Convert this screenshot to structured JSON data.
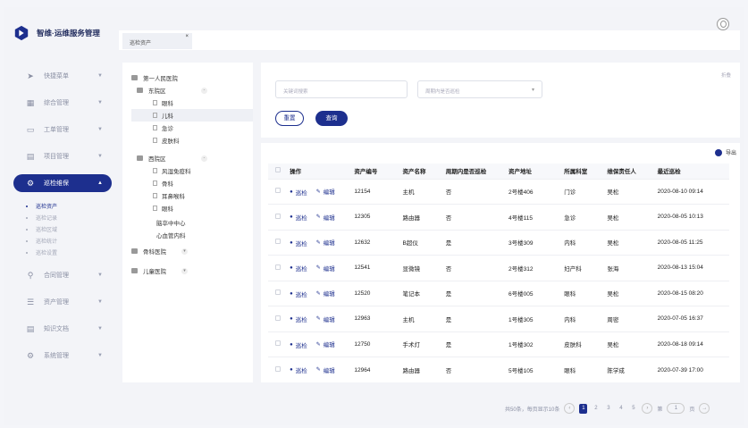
{
  "app": {
    "title": "智维·运维服务管理"
  },
  "sidebar": {
    "items": [
      {
        "label": "快捷菜单",
        "icon": "send-icon"
      },
      {
        "label": "综合管理",
        "icon": "grid-icon"
      },
      {
        "label": "工单管理",
        "icon": "ticket-icon"
      },
      {
        "label": "项目管理",
        "icon": "folder-icon"
      },
      {
        "label": "巡检维保",
        "icon": "wrench-icon",
        "active": true
      },
      {
        "label": "合同管理",
        "icon": "person-icon"
      },
      {
        "label": "资产管理",
        "icon": "database-icon"
      },
      {
        "label": "知识文档",
        "icon": "doc-icon"
      },
      {
        "label": "系统管理",
        "icon": "gear-icon"
      }
    ],
    "submenu": [
      {
        "label": "巡检资产",
        "active": true
      },
      {
        "label": "巡检记录"
      },
      {
        "label": "巡检区域"
      },
      {
        "label": "巡检统计"
      },
      {
        "label": "巡检设置"
      }
    ]
  },
  "topbar": {
    "tab_label": "巡检资产",
    "tab_close": "×"
  },
  "tree": {
    "root": "第一人民医院",
    "east": "东院区",
    "east_children": [
      "眼科",
      "儿科",
      "急诊",
      "皮肤科"
    ],
    "west": "西院区",
    "west_children": [
      "风湿免疫科",
      "骨科",
      "耳鼻喉科",
      "眼科"
    ],
    "extra": [
      "脑卒中中心",
      "心血管内科"
    ],
    "others": [
      "骨科医院",
      "儿童医院"
    ]
  },
  "search": {
    "keyword_placeholder": "关键词搜索",
    "select_placeholder": "周期内是否巡检",
    "fold_label": "折叠",
    "reset_label": "重置",
    "query_label": "查询"
  },
  "table": {
    "export_label": "导出",
    "headers": [
      "操作",
      "资产编号",
      "资产名称",
      "周期内是否巡检",
      "资产地址",
      "所属科室",
      "维保责任人",
      "最近巡检"
    ],
    "op_inspect": "巡检",
    "op_edit": "编辑",
    "rows": [
      [
        "12154",
        "主机",
        "否",
        "2号楼406",
        "门诊",
        "吴松",
        "2020-08-10 09:14"
      ],
      [
        "12305",
        "路由器",
        "否",
        "4号楼115",
        "急诊",
        "吴松",
        "2020-08-05 10:13"
      ],
      [
        "12632",
        "B超仪",
        "是",
        "3号楼309",
        "内科",
        "吴松",
        "2020-08-05 11:25"
      ],
      [
        "12541",
        "显微镜",
        "否",
        "2号楼312",
        "妇产科",
        "张海",
        "2020-08-13 15:04"
      ],
      [
        "12520",
        "笔记本",
        "是",
        "6号楼005",
        "眼科",
        "吴松",
        "2020-08-15 08:20"
      ],
      [
        "12963",
        "主机",
        "是",
        "1号楼305",
        "内科",
        "周密",
        "2020-07-05 16:37"
      ],
      [
        "12750",
        "手术灯",
        "是",
        "1号楼302",
        "皮肤科",
        "吴松",
        "2020-08-18 09:14"
      ],
      [
        "12964",
        "路由器",
        "否",
        "5号楼105",
        "眼科",
        "陈学成",
        "2020-07-39 17:00"
      ]
    ]
  },
  "pager": {
    "summary": "共50条，每页显示10条",
    "pages": [
      "1",
      "2",
      "3",
      "4",
      "5"
    ],
    "goto_prefix": "第",
    "goto_value": "1",
    "goto_suffix": "页",
    "prev": "‹",
    "next": "›",
    "go": "→"
  }
}
